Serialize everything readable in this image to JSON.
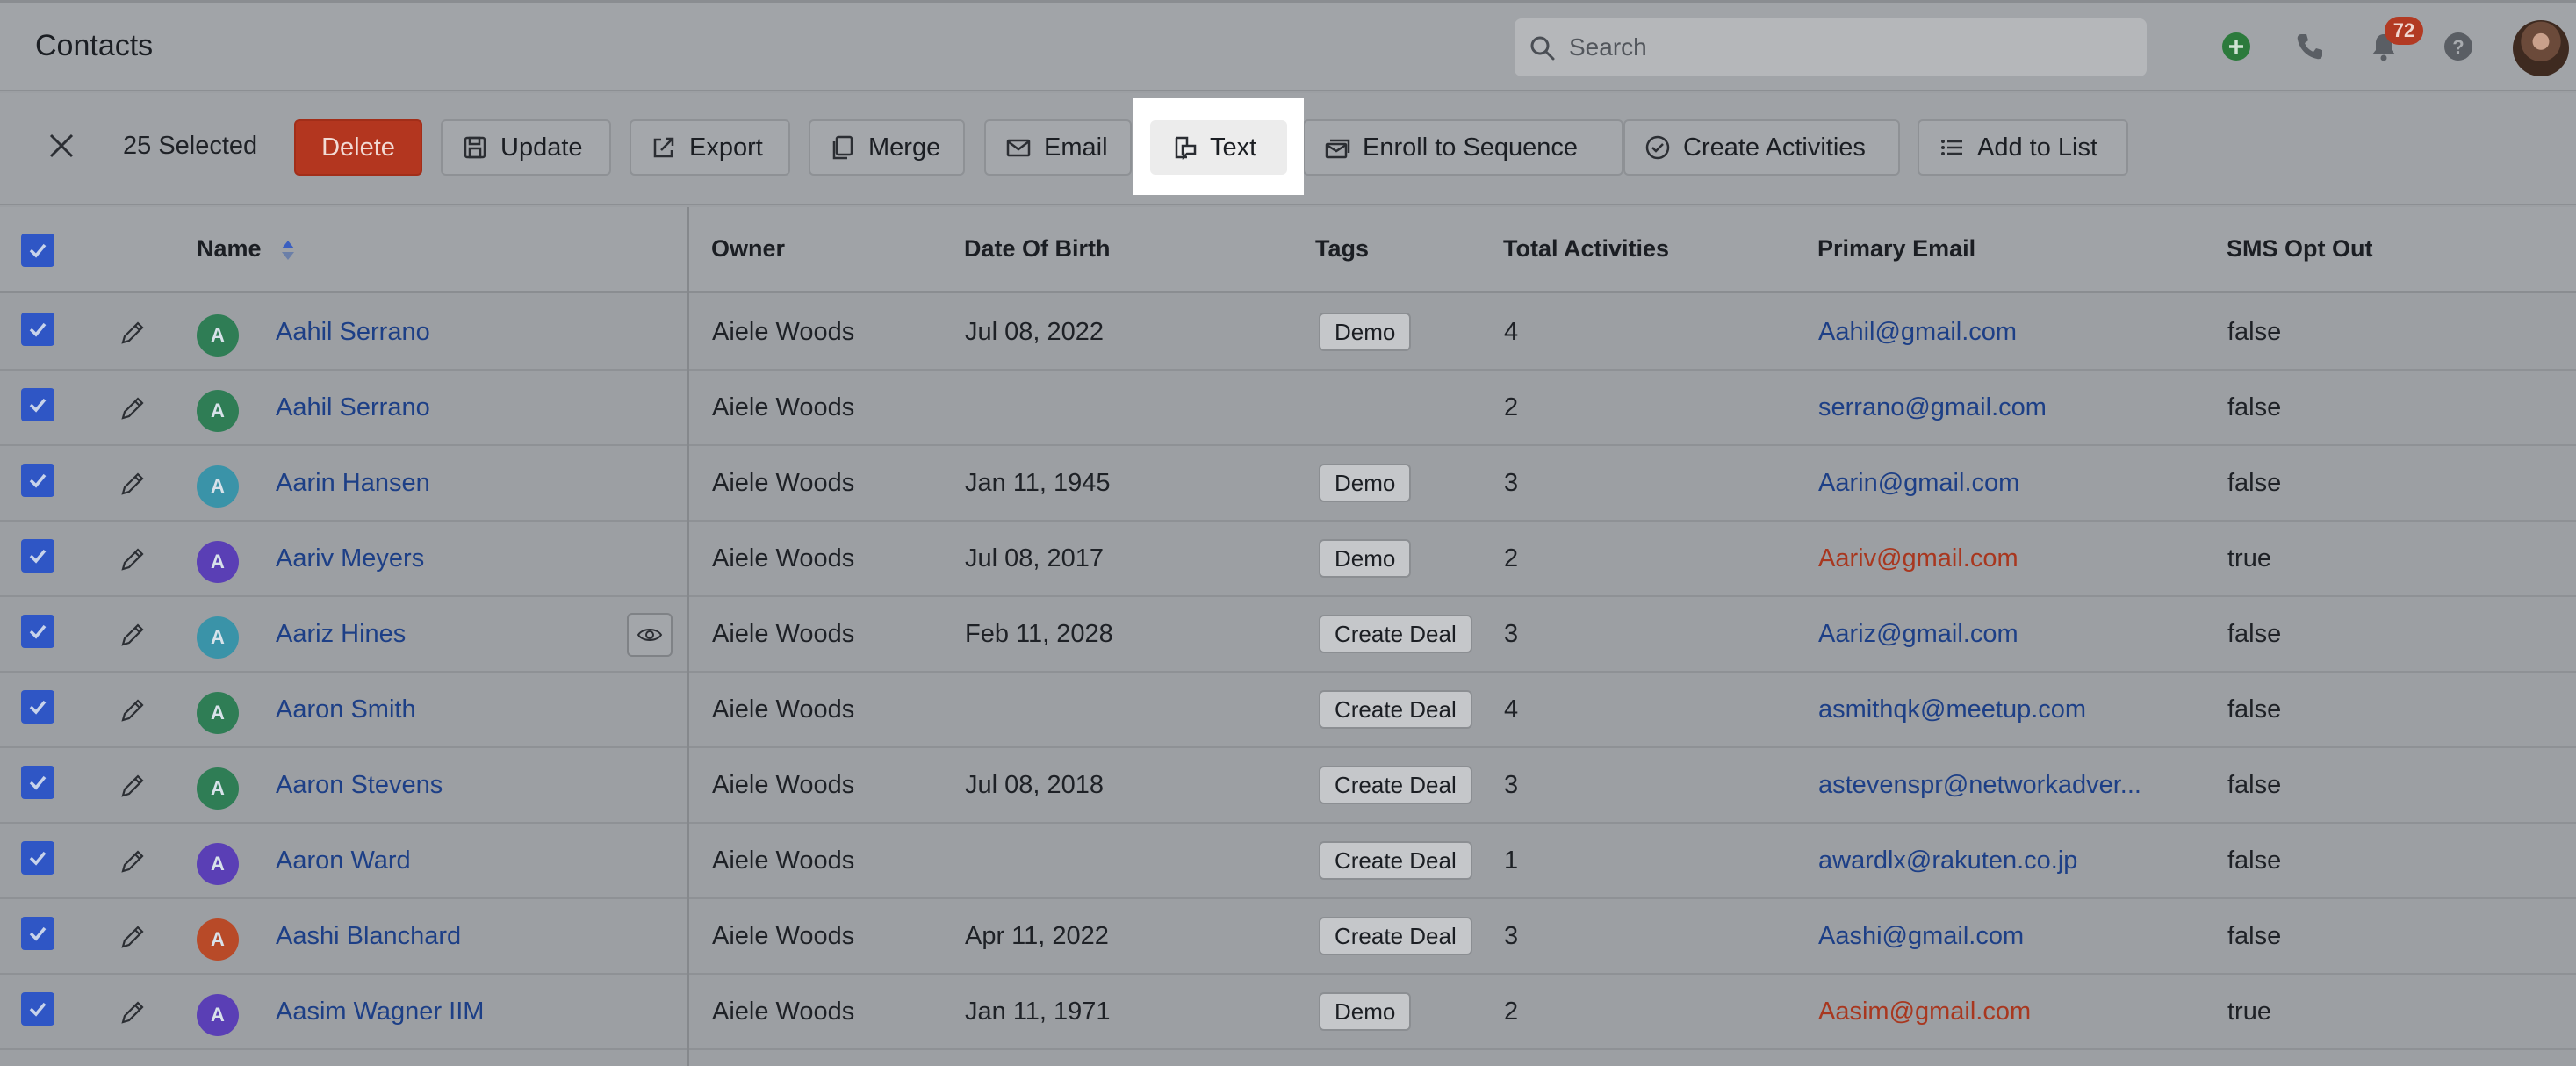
{
  "header": {
    "title": "Contacts",
    "search_placeholder": "Search",
    "notification_count": "72",
    "icons": [
      "plus-circle-icon",
      "phone-icon",
      "bell-icon",
      "help-icon"
    ]
  },
  "toolbar": {
    "selected_label": "25 Selected",
    "buttons": {
      "delete": "Delete",
      "update": "Update",
      "export": "Export",
      "merge": "Merge",
      "email": "Email",
      "text": "Text",
      "enroll": "Enroll to Sequence",
      "create_activities": "Create Activities",
      "add_to_list": "Add to List"
    }
  },
  "table": {
    "columns": {
      "name": "Name",
      "owner": "Owner",
      "dob": "Date Of Birth",
      "tags": "Tags",
      "total_activities": "Total Activities",
      "primary_email": "Primary Email",
      "sms_opt_out": "SMS Opt Out"
    },
    "rows": [
      {
        "initial": "A",
        "avatar_color": "#2f7d55",
        "name": "Aahil Serrano",
        "owner": "Aiele Woods",
        "dob": "Jul 08, 2022",
        "tag": "Demo",
        "activities": "4",
        "email": "Aahil@gmail.com",
        "email_style": "normal",
        "sms": "false"
      },
      {
        "initial": "A",
        "avatar_color": "#2f7d55",
        "name": "Aahil Serrano",
        "owner": "Aiele Woods",
        "dob": "",
        "tag": "",
        "activities": "2",
        "email": "serrano@gmail.com",
        "email_style": "normal",
        "sms": "false"
      },
      {
        "initial": "A",
        "avatar_color": "#3a93a8",
        "name": "Aarin Hansen",
        "owner": "Aiele Woods",
        "dob": "Jan 11, 1945",
        "tag": "Demo",
        "activities": "3",
        "email": "Aarin@gmail.com",
        "email_style": "normal",
        "sms": "false"
      },
      {
        "initial": "A",
        "avatar_color": "#5a3fb5",
        "name": "Aariv Meyers",
        "owner": "Aiele Woods",
        "dob": "Jul 08, 2017",
        "tag": "Demo",
        "activities": "2",
        "email": "Aariv@gmail.com",
        "email_style": "red",
        "sms": "true"
      },
      {
        "initial": "A",
        "avatar_color": "#3a93a8",
        "name": "Aariz Hines",
        "owner": "Aiele Woods",
        "dob": "Feb 11, 2028",
        "tag": "Create Deal",
        "activities": "3",
        "email": "Aariz@gmail.com",
        "email_style": "normal",
        "sms": "false"
      },
      {
        "initial": "A",
        "avatar_color": "#2f7d55",
        "name": "Aaron Smith",
        "owner": "Aiele Woods",
        "dob": "",
        "tag": "Create Deal",
        "activities": "4",
        "email": "asmithqk@meetup.com",
        "email_style": "normal",
        "sms": "false"
      },
      {
        "initial": "A",
        "avatar_color": "#2f7d55",
        "name": "Aaron Stevens",
        "owner": "Aiele Woods",
        "dob": "Jul 08, 2018",
        "tag": "Create Deal",
        "activities": "3",
        "email": "astevenspr@networkadver...",
        "email_style": "normal",
        "sms": "false"
      },
      {
        "initial": "A",
        "avatar_color": "#5a3fb5",
        "name": "Aaron Ward",
        "owner": "Aiele Woods",
        "dob": "",
        "tag": "Create Deal",
        "activities": "1",
        "email": "awardlx@rakuten.co.jp",
        "email_style": "normal",
        "sms": "false"
      },
      {
        "initial": "A",
        "avatar_color": "#b84a28",
        "name": "Aashi Blanchard",
        "owner": "Aiele Woods",
        "dob": "Apr 11, 2022",
        "tag": "Create Deal",
        "activities": "3",
        "email": "Aashi@gmail.com",
        "email_style": "normal",
        "sms": "false"
      },
      {
        "initial": "A",
        "avatar_color": "#5a3fb5",
        "name": "Aasim Wagner IIM",
        "owner": "Aiele Woods",
        "dob": "Jan 11, 1971",
        "tag": "Demo",
        "activities": "2",
        "email": "Aasim@gmail.com",
        "email_style": "red",
        "sms": "true"
      }
    ]
  },
  "colors": {
    "accent_blue": "#2f56c5",
    "danger": "#b3361f",
    "link": "#1d3f86"
  }
}
